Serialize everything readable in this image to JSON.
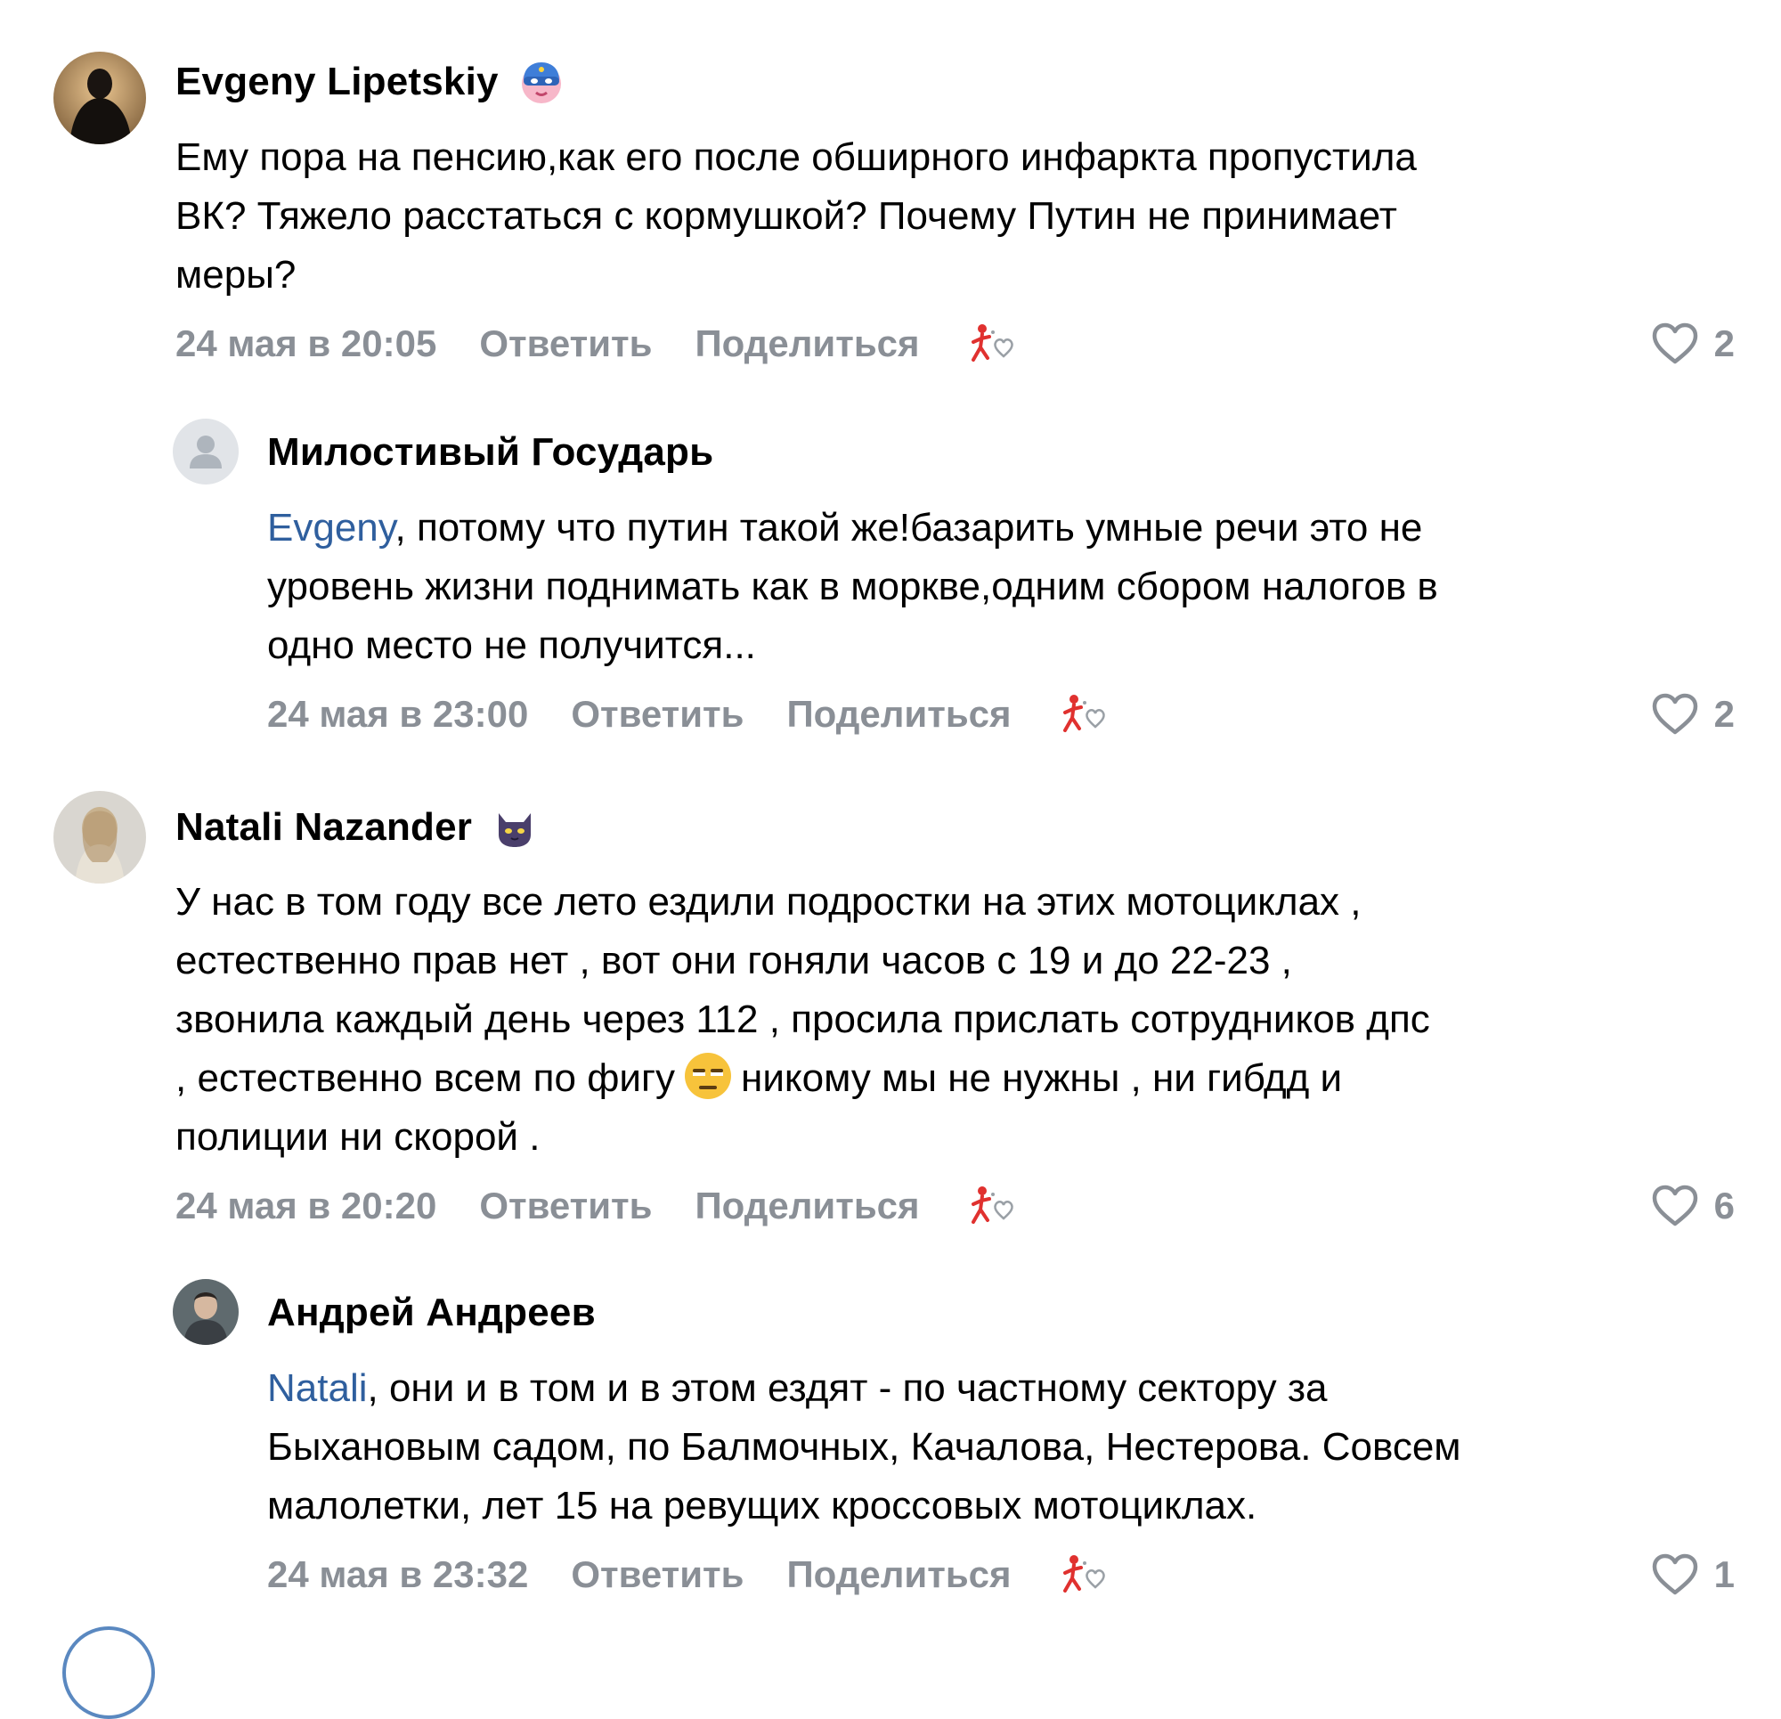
{
  "comments": [
    {
      "author": "Evgeny Lipetskiy",
      "badge_icon": "superhero-mask-icon",
      "lines": [
        "Ему пора на пенсию,как его после обширного инфаркта пропустила",
        "ВК? Тяжело расстаться с кормушкой? Почему Путин не принимает",
        "меры?"
      ],
      "time": "24 мая в 20:05",
      "reply_label": "Ответить",
      "share_label": "Поделиться",
      "likes": "2"
    },
    {
      "author": "Милостивый Государь",
      "mention": "Evgeny",
      "line1_rest": ", потому что путин такой же!базарить умные речи это не",
      "lines": [
        "уровень жизни поднимать как в моркве,одним сбором налогов в",
        "одно место не получится..."
      ],
      "time": "24 мая в 23:00",
      "reply_label": "Ответить",
      "share_label": "Поделиться",
      "likes": "2"
    },
    {
      "author": "Natali Nazander",
      "badge_icon": "black-cat-icon",
      "lines": [
        "У нас в том году все лето ездили подростки на этих мотоциклах ,",
        "естественно прав нет , вот они гоняли часов с 19 и до 22-23 ,",
        "звонила каждый день через 112 , просила прислать сотрудников дпс"
      ],
      "line4_before": ", естественно всем по фигу",
      "line4_after": "никому мы не нужны , ни гибдд и",
      "line5": "полиции ни скорой .",
      "time": "24 мая в 20:20",
      "reply_label": "Ответить",
      "share_label": "Поделиться",
      "likes": "6"
    },
    {
      "author": "Андрей Андреев",
      "mention": "Natali",
      "line1_rest": ", они и в том и в этом ездят - по частному сектору за",
      "lines": [
        "Быхановым садом, по Балмочных, Качалова, Нестерова. Совсем",
        "малолетки, лет 15 на ревущих кроссовых мотоциклах."
      ],
      "time": "24 мая в 23:32",
      "reply_label": "Ответить",
      "share_label": "Поделиться",
      "likes": "1"
    }
  ],
  "icons": {
    "like": "heart-icon",
    "reaction": "reaction-icon",
    "inline_emoji": "expressionless-face-icon"
  },
  "colors": {
    "mention": "#2f5f9e",
    "meta": "#8a8f96"
  }
}
